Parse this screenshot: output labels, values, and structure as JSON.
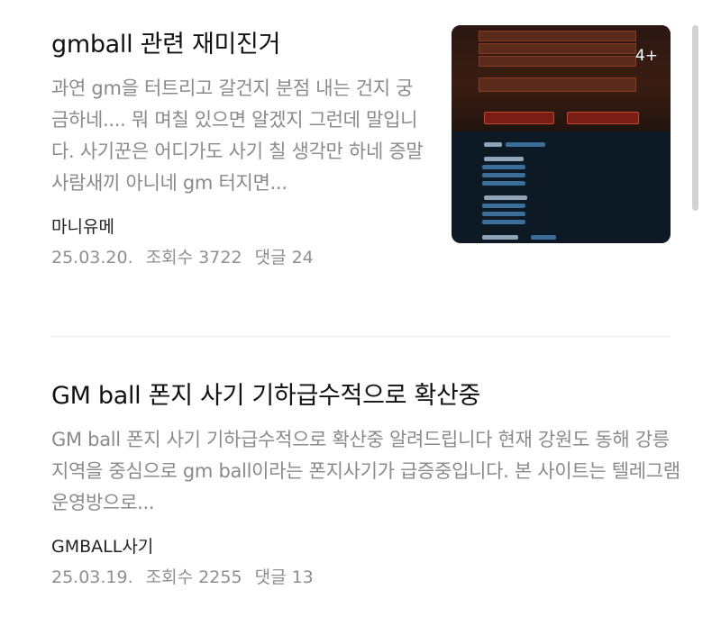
{
  "posts": [
    {
      "title": "gmball 관련 재미진거",
      "excerpt": "과연 gm을 터트리고 갈건지 분점 내는 건지 궁금하네.... 뭐 며칠 있으면 알겠지 그런데 말입니다. 사기꾼은 어디가도 사기 칠 생각만 하네 증말 사람새끼 아니네 gm 터지면...",
      "author": "마니유메",
      "date": "25.03.20.",
      "views_label": "조회수 3722",
      "comments_label": "댓글 24",
      "thumbnail": {
        "count_badge": "4+"
      }
    },
    {
      "title": "GM ball 폰지 사기 기하급수적으로 확산중",
      "excerpt": "GM ball 폰지 사기 기하급수적으로 확산중 알려드립니다 현재 강원도 동해 강릉 지역을 중심으로 gm ball이라는 폰지사기가 급증중입니다. 본 사이트는 텔레그램운영방으로...",
      "author": "GMBALL사기",
      "date": "25.03.19.",
      "views_label": "조회수 2255",
      "comments_label": "댓글 13"
    }
  ],
  "colors": {
    "title": "#111111",
    "excerpt": "#8a8a8a",
    "meta": "#8f8f8f",
    "divider": "#ececec"
  }
}
